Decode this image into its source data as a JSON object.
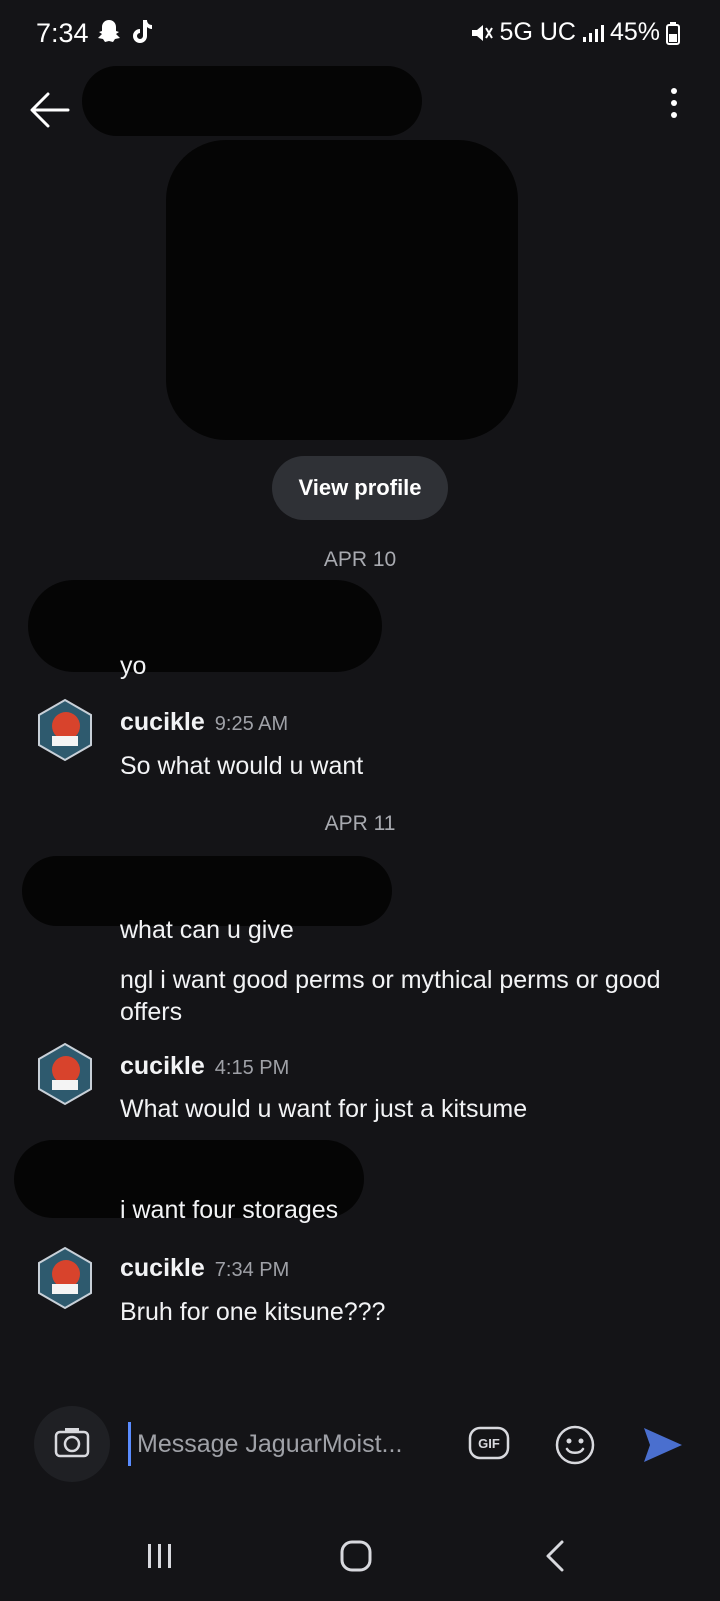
{
  "status_bar": {
    "time": "7:34",
    "network": "5G UC",
    "battery": "45%"
  },
  "header": {
    "back_icon": "arrow-left-icon",
    "more_icon": "more-vertical-icon"
  },
  "profile": {
    "view_profile_label": "View profile"
  },
  "messages": {
    "date_1": "APR 10",
    "date_2": "APR 11",
    "m1_text": "yo",
    "g1_author": "cucikle",
    "g1_time": "9:25 AM",
    "g1_text": "So what would u want",
    "m2_text": "what can u give",
    "m3_text": "ngl i want good perms or mythical perms or good offers",
    "g2_author": "cucikle",
    "g2_time": "4:15 PM",
    "g2_text": "What would u want for just a kitsume",
    "m4_text": "i want four storages",
    "g3_author": "cucikle",
    "g3_time": "7:34 PM",
    "g3_text": "Bruh for one kitsune???"
  },
  "composer": {
    "placeholder": "Message JaguarMoist...",
    "camera_icon": "camera-icon",
    "gif_label": "GIF",
    "emoji_icon": "emoji-icon",
    "send_icon": "send-icon"
  },
  "nav": {
    "recents_icon": "recents-icon",
    "home_icon": "home-icon",
    "back_icon": "nav-back-icon"
  },
  "colors": {
    "background": "#141417",
    "accent": "#5a8cff",
    "muted": "#9fa1a7"
  }
}
